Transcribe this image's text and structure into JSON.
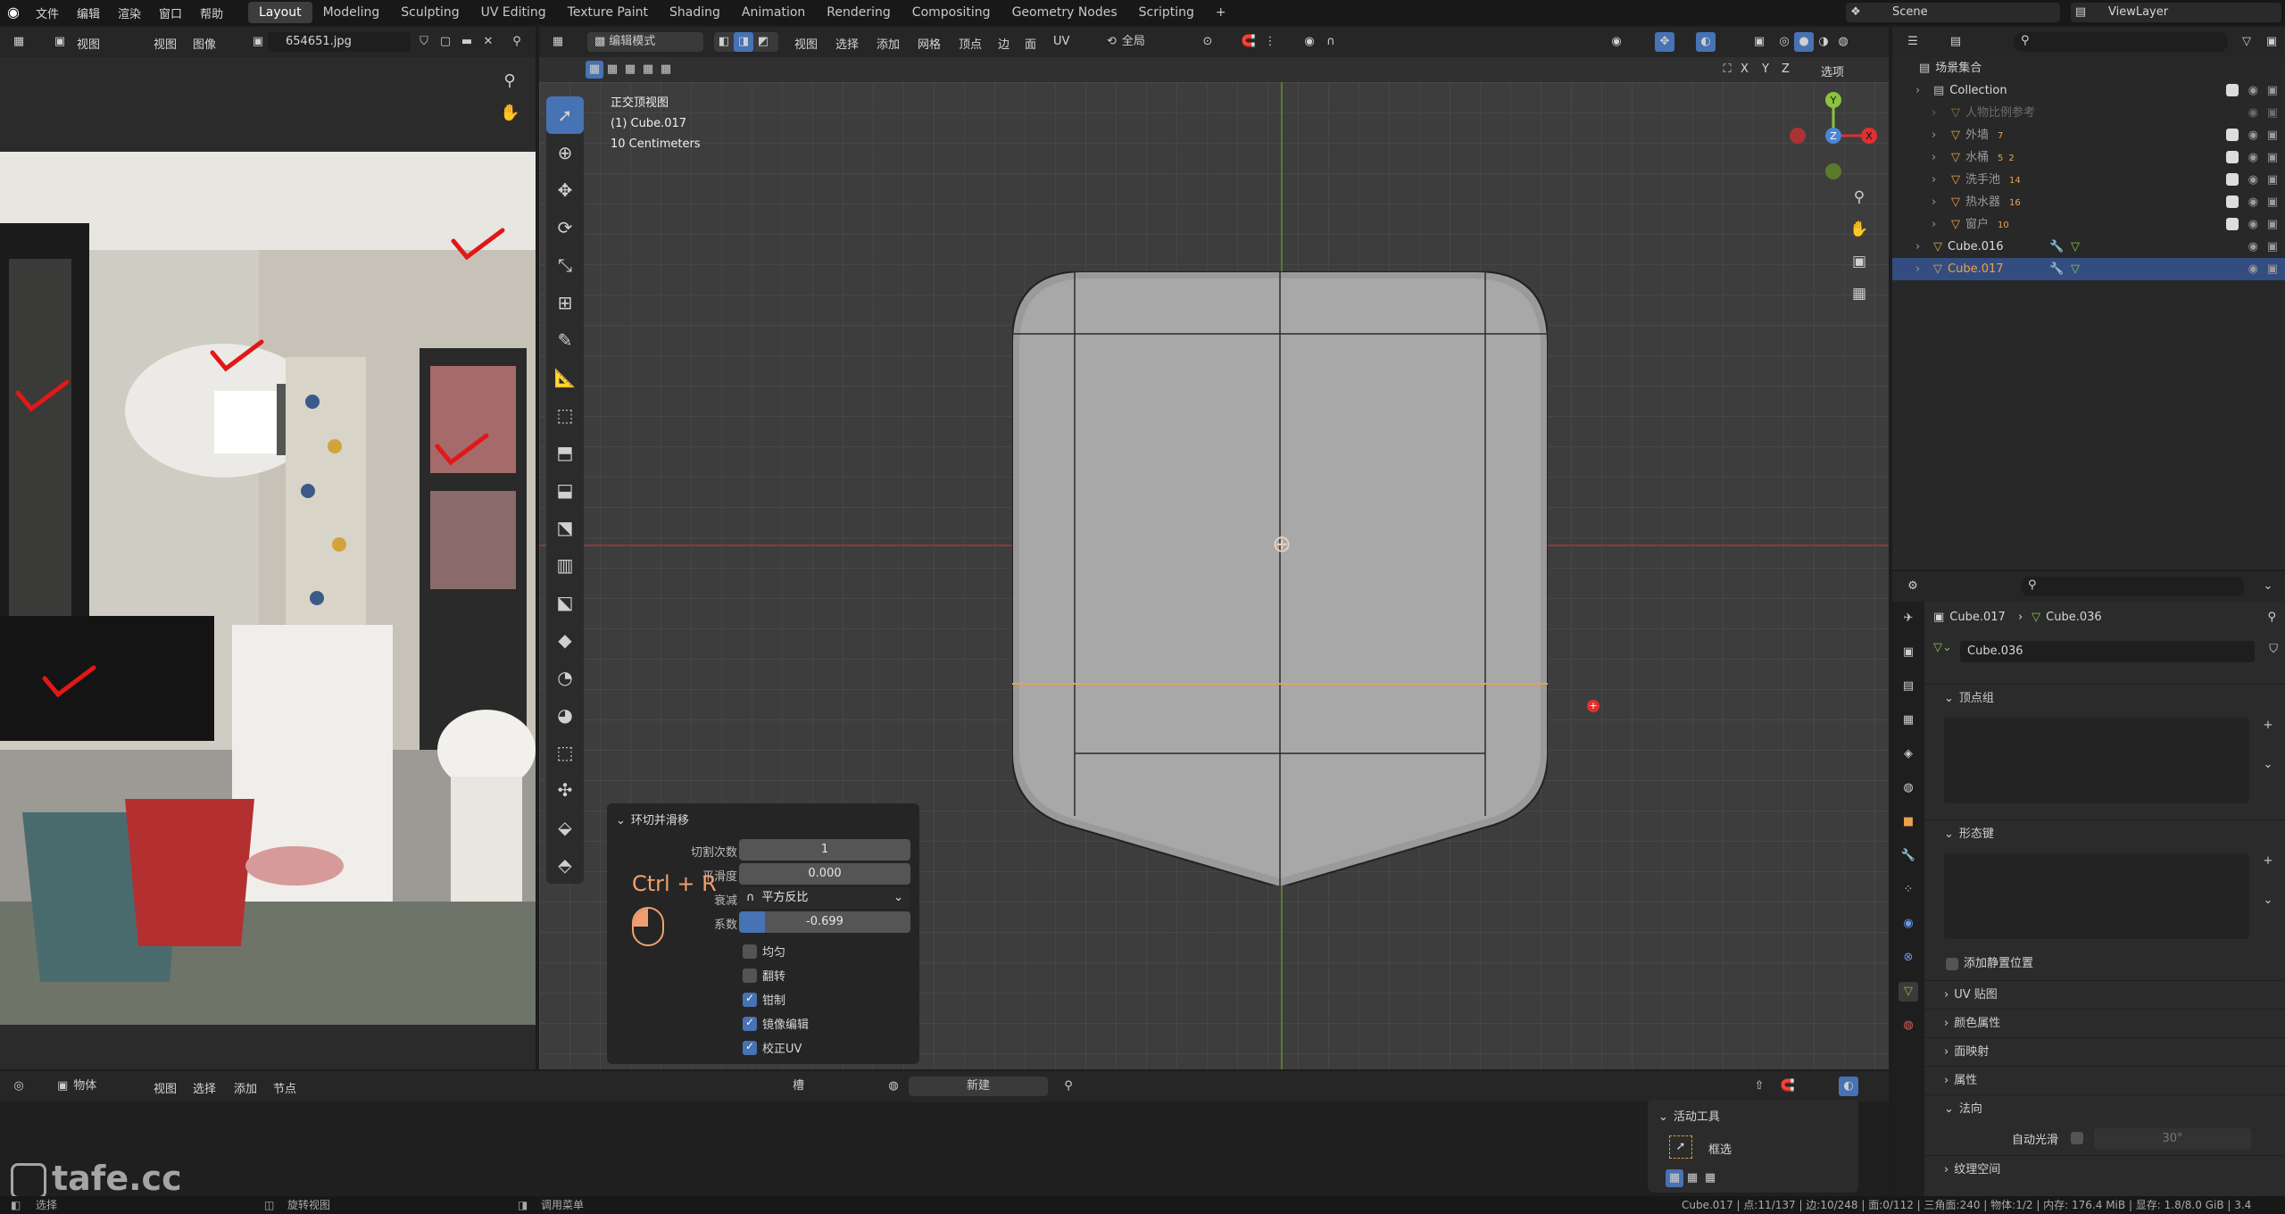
{
  "menu": {
    "items": [
      "文件",
      "编辑",
      "渲染",
      "窗口",
      "帮助"
    ]
  },
  "tabs": [
    "Layout",
    "Modeling",
    "Sculpting",
    "UV Editing",
    "Texture Paint",
    "Shading",
    "Animation",
    "Rendering",
    "Compositing",
    "Geometry Nodes",
    "Scripting",
    "+"
  ],
  "scene": {
    "scene_name": "Scene",
    "view_layer": "ViewLayer"
  },
  "image_editor": {
    "view_menu": "视图",
    "menus": [
      "视图",
      "图像"
    ],
    "image_name": "654651.jpg"
  },
  "viewport": {
    "mode": "编辑模式",
    "menus": [
      "视图",
      "选择",
      "添加",
      "网格",
      "顶点",
      "边",
      "面",
      "UV"
    ],
    "transform_orientation": "全局",
    "overlay_info": [
      "正交顶视图",
      "(1) Cube.017",
      "10 Centimeters"
    ],
    "mirror_axes": [
      "X",
      "Y",
      "Z"
    ],
    "options": "选项",
    "gizmo": {
      "x": "X",
      "y": "Y",
      "z": "Z"
    }
  },
  "operator_panel": {
    "title": "环切并滑移",
    "cuts_label": "切割次数",
    "cuts": "1",
    "smooth_label": "平滑度",
    "smooth": "0.000",
    "falloff_label": "衰减",
    "falloff": "平方反比",
    "factor_label": "系数",
    "factor": "-0.699",
    "factor_fill": 0.15,
    "checkboxes": [
      {
        "label": "均匀",
        "on": false
      },
      {
        "label": "翻转",
        "on": false
      },
      {
        "label": "钳制",
        "on": true
      },
      {
        "label": "镜像编辑",
        "on": true
      },
      {
        "label": "校正UV",
        "on": true
      }
    ]
  },
  "shortcut": "Ctrl + R",
  "outliner": {
    "root": "场景集合",
    "items": [
      {
        "name": "Collection",
        "level": 1,
        "check": true
      },
      {
        "name": "人物比例参考",
        "level": 2,
        "check": false
      },
      {
        "name": "外墙",
        "level": 2,
        "check": true,
        "count": "7"
      },
      {
        "name": "水桶",
        "level": 2,
        "check": true,
        "count": "5",
        "count2": "2"
      },
      {
        "name": "洗手池",
        "level": 2,
        "check": true,
        "count": "14"
      },
      {
        "name": "热水器",
        "level": 2,
        "check": true,
        "count": "16"
      },
      {
        "name": "窗户",
        "level": 2,
        "check": true,
        "count": "10"
      },
      {
        "name": "Cube.016",
        "level": 1,
        "check": false
      },
      {
        "name": "Cube.017",
        "level": 1,
        "check": false,
        "selected": true
      }
    ]
  },
  "properties": {
    "object": "Cube.017",
    "mesh": "Cube.036",
    "mesh_field": "Cube.036",
    "sections": [
      "顶点组",
      "形态键",
      "UV 贴图",
      "颜色属性",
      "面映射",
      "属性",
      "法向",
      "纹理空间"
    ],
    "add_rest": "添加静置位置",
    "autosmooth_label": "自动光滑",
    "autosmooth": "30°"
  },
  "bottom_editor": {
    "mode": "物体",
    "menus": [
      "视图",
      "选择",
      "添加",
      "节点"
    ],
    "slot": "槽",
    "new": "新建"
  },
  "active_tool": {
    "title": "活动工具",
    "tool": "框选"
  },
  "status": {
    "left": "选择",
    "mid1": "旋转视图",
    "mid2": "调用菜单",
    "right": "Cube.017 | 点:11/137 | 边:10/248 | 面:0/112 | 三角面:240 | 物体:1/2 | 内存: 176.4 MiB | 显存: 1.8/8.0 GiB | 3.4"
  },
  "watermark": "tafe.cc",
  "colors": {
    "accent": "#4772b3",
    "orange": "#e8a24d",
    "red": "#e03030",
    "green": "#8ac43d",
    "blue": "#4a86d8"
  }
}
